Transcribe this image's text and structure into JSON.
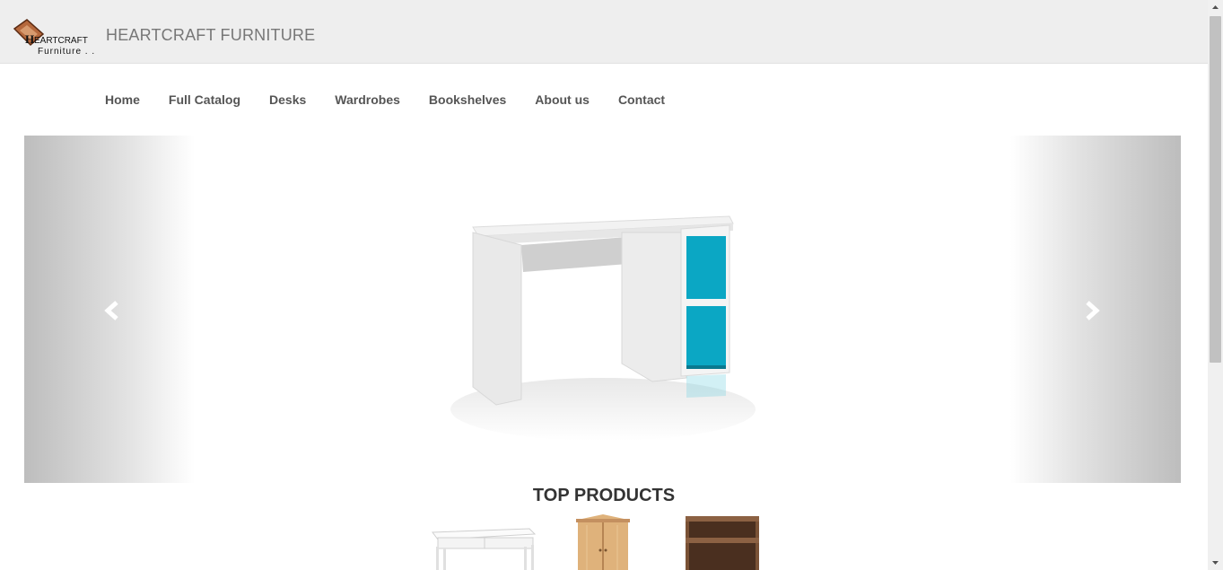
{
  "header": {
    "brand": "HEARTCRAFT FURNITURE",
    "logo": {
      "line1": "HEARTCRAFT",
      "line2": "Furniture",
      "accent": "#8b3b1f"
    }
  },
  "nav": {
    "items": [
      {
        "label": "Home"
      },
      {
        "label": "Full Catalog"
      },
      {
        "label": "Desks"
      },
      {
        "label": "Wardrobes"
      },
      {
        "label": "Bookshelves"
      },
      {
        "label": "About us"
      },
      {
        "label": "Contact"
      }
    ]
  },
  "carousel": {
    "prev_icon": "chevron-left-icon",
    "next_icon": "chevron-right-icon",
    "slide_accent": "#0ba7c4"
  },
  "products": {
    "heading": "TOP PRODUCTS",
    "items": [
      {
        "image": "white-desk"
      },
      {
        "image": "pine-wardrobe"
      },
      {
        "image": "brown-bookshelf"
      }
    ]
  }
}
